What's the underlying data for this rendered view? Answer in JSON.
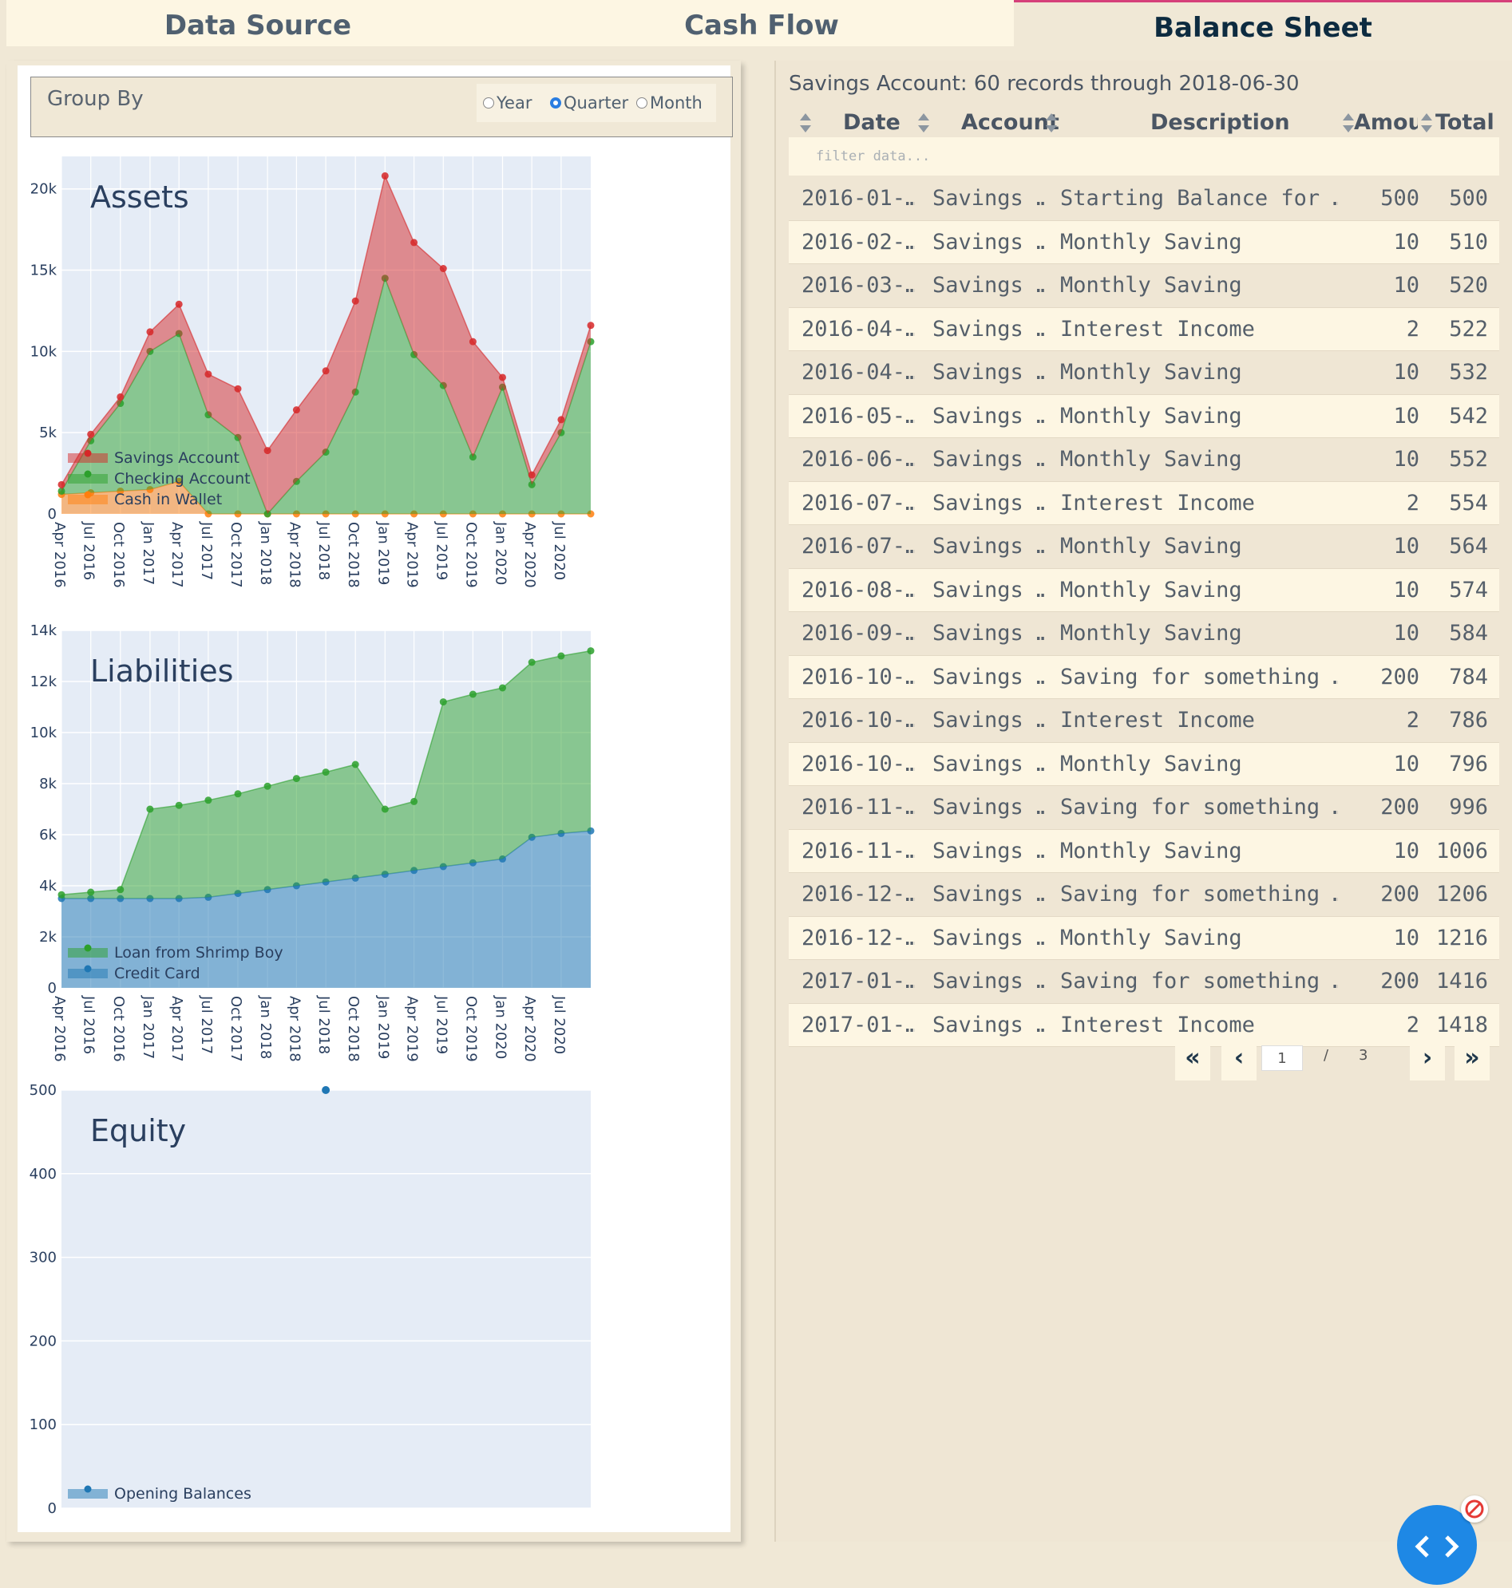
{
  "tabs": [
    {
      "label": "Data Source"
    },
    {
      "label": "Cash Flow"
    },
    {
      "label": "Balance Sheet"
    }
  ],
  "groupby": {
    "title": "Group By",
    "options": [
      {
        "label": "Year",
        "selected": false
      },
      {
        "label": "Quarter",
        "selected": true
      },
      {
        "label": "Month",
        "selected": false
      }
    ]
  },
  "x_ticks": [
    "Apr 2016",
    "Jul 2016",
    "Oct 2016",
    "Jan 2017",
    "Apr 2017",
    "Jul 2017",
    "Oct 2017",
    "Jan 2018",
    "Apr 2018",
    "Jul 2018",
    "Oct 2018",
    "Jan 2019",
    "Apr 2019",
    "Jul 2019",
    "Oct 2019",
    "Jan 2020",
    "Apr 2020",
    "Jul 2020"
  ],
  "colors": {
    "savings": "#d62728",
    "checking": "#2ca02c",
    "cash": "#ff7f0e",
    "blue": "#1f77b4",
    "plot_bg": "#e5ecf6"
  },
  "chart_data": [
    {
      "type": "area",
      "title": "Assets",
      "ylim": [
        0,
        22000
      ],
      "yticks": [
        0,
        5000,
        10000,
        15000,
        20000
      ],
      "ytick_labels": [
        "0",
        "5k",
        "10k",
        "15k",
        "20k"
      ],
      "x": [
        "2016-03-31",
        "2016-06-30",
        "2016-09-30",
        "2016-12-31",
        "2017-03-31",
        "2017-06-30",
        "2017-09-30",
        "2017-12-31",
        "2018-03-31",
        "2018-06-30",
        "2018-09-30",
        "2018-12-31",
        "2019-03-31",
        "2019-06-30",
        "2019-09-30",
        "2019-12-31",
        "2020-03-31",
        "2020-06-30",
        "2020-09-30"
      ],
      "stacked": true,
      "series": [
        {
          "name": "Cash in Wallet",
          "color": "#ff7f0e",
          "values": [
            1200,
            1300,
            1400,
            1500,
            2000,
            0,
            0,
            0,
            0,
            0,
            0,
            0,
            0,
            0,
            0,
            0,
            0,
            0,
            0
          ]
        },
        {
          "name": "Checking Account",
          "color": "#2ca02c",
          "values": [
            200,
            3200,
            5400,
            8500,
            9100,
            6100,
            4700,
            0,
            2000,
            3800,
            7500,
            14500,
            9800,
            7900,
            3500,
            7800,
            1800,
            5000,
            10600
          ]
        },
        {
          "name": "Savings Account",
          "color": "#d62728",
          "values": [
            400,
            400,
            400,
            1200,
            1800,
            2500,
            3000,
            3900,
            4400,
            5000,
            5600,
            6300,
            6900,
            7200,
            7100,
            600,
            600,
            800,
            1000
          ]
        }
      ],
      "legend": "bottom-left"
    },
    {
      "type": "area",
      "title": "Liabilities",
      "ylim": [
        0,
        14000
      ],
      "yticks": [
        0,
        2000,
        4000,
        6000,
        8000,
        10000,
        12000,
        14000
      ],
      "ytick_labels": [
        "0",
        "2k",
        "4k",
        "6k",
        "8k",
        "10k",
        "12k",
        "14k"
      ],
      "x": [
        "2016-03-31",
        "2016-06-30",
        "2016-09-30",
        "2016-12-31",
        "2017-03-31",
        "2017-06-30",
        "2017-09-30",
        "2017-12-31",
        "2018-03-31",
        "2018-06-30",
        "2018-09-30",
        "2018-12-31",
        "2019-03-31",
        "2019-06-30",
        "2019-09-30",
        "2019-12-31",
        "2020-03-31",
        "2020-06-30",
        "2020-09-30"
      ],
      "stacked": true,
      "series": [
        {
          "name": "Credit Card",
          "color": "#1f77b4",
          "values": [
            3500,
            3500,
            3500,
            3500,
            3500,
            3550,
            3700,
            3850,
            4000,
            4150,
            4300,
            4450,
            4600,
            4750,
            4900,
            5050,
            5900,
            6050,
            6150
          ]
        },
        {
          "name": "Loan from Shrimp Boy",
          "color": "#2ca02c",
          "values": [
            150,
            250,
            350,
            3500,
            3650,
            3800,
            3900,
            4050,
            4200,
            4300,
            4450,
            2550,
            2700,
            6450,
            6600,
            6700,
            6850,
            6950,
            7050
          ]
        }
      ],
      "legend": "bottom-left"
    },
    {
      "type": "scatter",
      "title": "Equity",
      "ylim": [
        0,
        500
      ],
      "yticks": [
        0,
        100,
        200,
        300,
        400,
        500
      ],
      "ytick_labels": [
        "0",
        "100",
        "200",
        "300",
        "400",
        "500"
      ],
      "series": [
        {
          "name": "Opening Balances",
          "color": "#1f77b4",
          "x": [
            "2018-06-30"
          ],
          "values": [
            500
          ]
        }
      ],
      "legend": "bottom-left"
    }
  ],
  "table": {
    "title": "Savings Account: 60 records through 2018-06-30",
    "columns": [
      "Date",
      "Account",
      "Description",
      "Amour",
      "Total"
    ],
    "filter_placeholder": "filter data...",
    "rows": [
      {
        "date": "2016-01-…",
        "account": "Savings …",
        "description": "Starting Balance for …",
        "amount": "500",
        "total": "500"
      },
      {
        "date": "2016-02-…",
        "account": "Savings …",
        "description": "Monthly Saving",
        "amount": "10",
        "total": "510"
      },
      {
        "date": "2016-03-…",
        "account": "Savings …",
        "description": "Monthly Saving",
        "amount": "10",
        "total": "520"
      },
      {
        "date": "2016-04-…",
        "account": "Savings …",
        "description": "Interest Income",
        "amount": "2",
        "total": "522"
      },
      {
        "date": "2016-04-…",
        "account": "Savings …",
        "description": "Monthly Saving",
        "amount": "10",
        "total": "532"
      },
      {
        "date": "2016-05-…",
        "account": "Savings …",
        "description": "Monthly Saving",
        "amount": "10",
        "total": "542"
      },
      {
        "date": "2016-06-…",
        "account": "Savings …",
        "description": "Monthly Saving",
        "amount": "10",
        "total": "552"
      },
      {
        "date": "2016-07-…",
        "account": "Savings …",
        "description": "Interest Income",
        "amount": "2",
        "total": "554"
      },
      {
        "date": "2016-07-…",
        "account": "Savings …",
        "description": "Monthly Saving",
        "amount": "10",
        "total": "564"
      },
      {
        "date": "2016-08-…",
        "account": "Savings …",
        "description": "Monthly Saving",
        "amount": "10",
        "total": "574"
      },
      {
        "date": "2016-09-…",
        "account": "Savings …",
        "description": "Monthly Saving",
        "amount": "10",
        "total": "584"
      },
      {
        "date": "2016-10-…",
        "account": "Savings …",
        "description": "Saving for something …",
        "amount": "200",
        "total": "784"
      },
      {
        "date": "2016-10-…",
        "account": "Savings …",
        "description": "Interest Income",
        "amount": "2",
        "total": "786"
      },
      {
        "date": "2016-10-…",
        "account": "Savings …",
        "description": "Monthly Saving",
        "amount": "10",
        "total": "796"
      },
      {
        "date": "2016-11-…",
        "account": "Savings …",
        "description": "Saving for something …",
        "amount": "200",
        "total": "996"
      },
      {
        "date": "2016-11-…",
        "account": "Savings …",
        "description": "Monthly Saving",
        "amount": "10",
        "total": "1006"
      },
      {
        "date": "2016-12-…",
        "account": "Savings …",
        "description": "Saving for something …",
        "amount": "200",
        "total": "1206"
      },
      {
        "date": "2016-12-…",
        "account": "Savings …",
        "description": "Monthly Saving",
        "amount": "10",
        "total": "1216"
      },
      {
        "date": "2017-01-…",
        "account": "Savings …",
        "description": "Saving for something …",
        "amount": "200",
        "total": "1416"
      },
      {
        "date": "2017-01-…",
        "account": "Savings …",
        "description": "Interest Income",
        "amount": "2",
        "total": "1418"
      }
    ],
    "pagination": {
      "current": "1",
      "separator": "/",
      "total": "3"
    }
  }
}
